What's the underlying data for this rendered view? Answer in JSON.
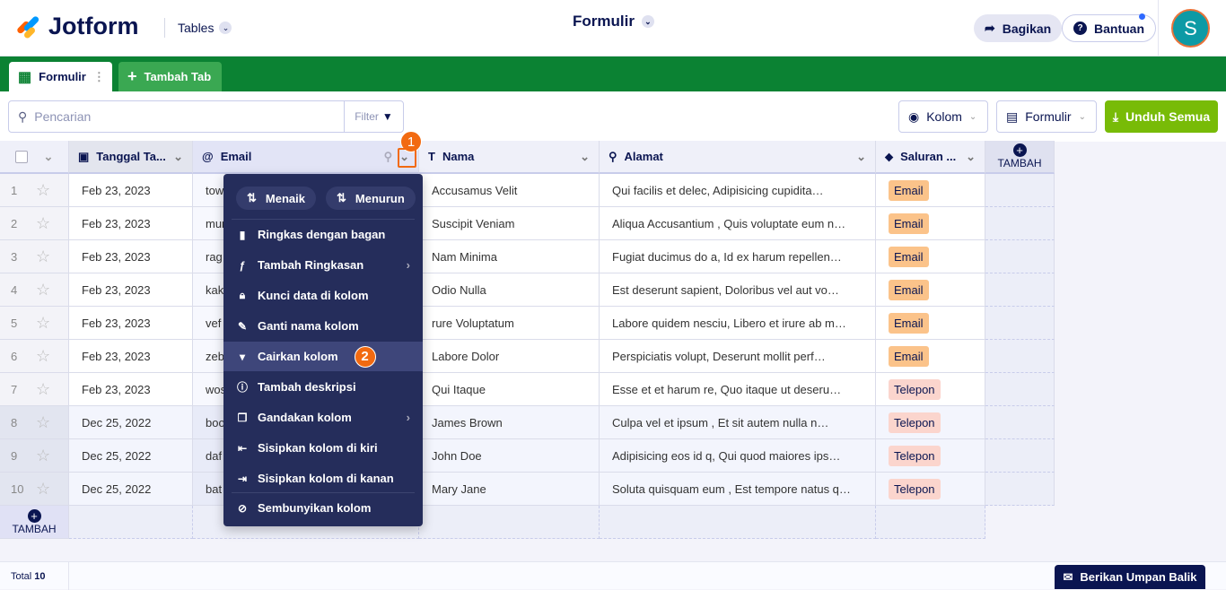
{
  "header": {
    "logo": "Jotform",
    "product": "Tables",
    "title": "Formulir",
    "share": "Bagikan",
    "help": "Bantuan",
    "avatar": "S"
  },
  "tabs": [
    {
      "label": "Formulir"
    },
    {
      "label": "Tambah Tab"
    }
  ],
  "toolbar": {
    "search_placeholder": "Pencarian",
    "filter": "Filter",
    "columns": "Kolom",
    "form": "Formulir",
    "download": "Unduh Semua"
  },
  "columns": [
    {
      "label": "Tanggal Ta..."
    },
    {
      "label": "Email"
    },
    {
      "label": "Nama"
    },
    {
      "label": "Alamat"
    },
    {
      "label": "Saluran ..."
    }
  ],
  "add_label": "TAMBAH",
  "rows": [
    {
      "n": "1",
      "date": "Feb 23, 2023",
      "email": "tow",
      "name": "Accusamus Velit",
      "addr": "Qui facilis et delec, Adipisicing cupidita…",
      "ch": "Email"
    },
    {
      "n": "2",
      "date": "Feb 23, 2023",
      "email": "mur",
      "name": "Suscipit Veniam",
      "addr": "Aliqua Accusantium , Quis voluptate eum n…",
      "ch": "Email"
    },
    {
      "n": "3",
      "date": "Feb 23, 2023",
      "email": "rag",
      "name": "Nam Minima",
      "addr": "Fugiat ducimus do a, Id ex harum repellen…",
      "ch": "Email"
    },
    {
      "n": "4",
      "date": "Feb 23, 2023",
      "email": "kak",
      "name": "Odio Nulla",
      "addr": "Est deserunt sapient, Doloribus vel aut vo…",
      "ch": "Email"
    },
    {
      "n": "5",
      "date": "Feb 23, 2023",
      "email": "vef",
      "name": "rure Voluptatum",
      "addr": "Labore quidem nesciu, Libero et irure ab m…",
      "ch": "Email"
    },
    {
      "n": "6",
      "date": "Feb 23, 2023",
      "email": "zeb",
      "name": "Labore Dolor",
      "addr": "Perspiciatis volupt, Deserunt mollit perf…",
      "ch": "Email"
    },
    {
      "n": "7",
      "date": "Feb 23, 2023",
      "email": "wos",
      "name": "Qui Itaque",
      "addr": "Esse et et harum re, Quo itaque ut deseru…",
      "ch": "Telepon"
    },
    {
      "n": "8",
      "date": "Dec 25, 2022",
      "email": "boo",
      "name": "James Brown",
      "addr": "Culpa vel et ipsum , Et sit autem nulla n…",
      "ch": "Telepon"
    },
    {
      "n": "9",
      "date": "Dec 25, 2022",
      "email": "daf",
      "name": "John Doe",
      "addr": "Adipisicing eos id q, Qui quod maiores ips…",
      "ch": "Telepon"
    },
    {
      "n": "10",
      "date": "Dec 25, 2022",
      "email": "bat",
      "name": "Mary Jane",
      "addr": "Soluta quisquam eum , Est tempore natus q…",
      "ch": "Telepon"
    }
  ],
  "badge_colors": {
    "Email": "#fbc38a",
    "Telepon": "#fbd5cd"
  },
  "menu": {
    "asc": "Menaik",
    "desc": "Menurun",
    "items": [
      {
        "icon": "bar-chart",
        "label": "Ringkas dengan bagan"
      },
      {
        "icon": "function",
        "label": "Tambah Ringkasan",
        "sub": true
      },
      {
        "icon": "lock",
        "label": "Kunci data di kolom"
      },
      {
        "icon": "rename",
        "label": "Ganti nama kolom"
      },
      {
        "icon": "pin",
        "label": "Cairkan kolom",
        "active": true
      },
      {
        "icon": "info",
        "label": "Tambah deskripsi"
      },
      {
        "icon": "duplicate",
        "label": "Gandakan kolom",
        "sub": true
      },
      {
        "icon": "insert-left",
        "label": "Sisipkan kolom di kiri"
      },
      {
        "icon": "insert-right",
        "label": "Sisipkan kolom di kanan"
      },
      {
        "icon": "eye-off",
        "label": "Sembunyikan kolom"
      }
    ]
  },
  "steps": [
    "1",
    "2"
  ],
  "footer": {
    "total_label": "Total",
    "total": "10",
    "feedback": "Berikan Umpan Balik"
  }
}
